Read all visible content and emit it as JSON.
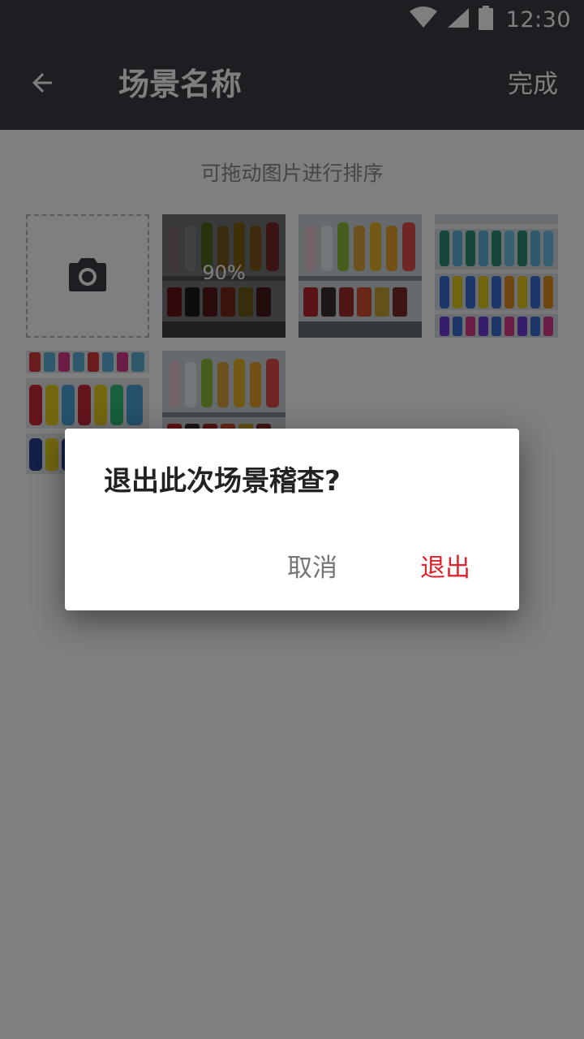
{
  "status_bar": {
    "time": "12:30",
    "icons": [
      "wifi-icon",
      "cell-signal-icon",
      "battery-icon"
    ]
  },
  "app_bar": {
    "title": "场景名称",
    "done_label": "完成",
    "back_icon": "arrow-left-icon"
  },
  "hint": "可拖动图片进行排序",
  "photos": {
    "add_icon": "camera-icon",
    "upload_progress": "90%",
    "items": [
      {
        "desc": "vending-machine-drinks-1",
        "status": "uploading"
      },
      {
        "desc": "vending-machine-drinks-2",
        "status": "done"
      },
      {
        "desc": "bottled-water-shelf",
        "status": "done"
      },
      {
        "desc": "sports-drinks-shelf",
        "status": "done"
      },
      {
        "desc": "vending-machine-drinks-3",
        "status": "done"
      }
    ]
  },
  "dialog": {
    "title": "退出此次场景稽查?",
    "cancel_label": "取消",
    "confirm_label": "退出",
    "confirm_color": "#e0242f"
  },
  "colors": {
    "app_bar": "#3a3d45",
    "scrim": "rgba(0,0,0,0.5)"
  }
}
